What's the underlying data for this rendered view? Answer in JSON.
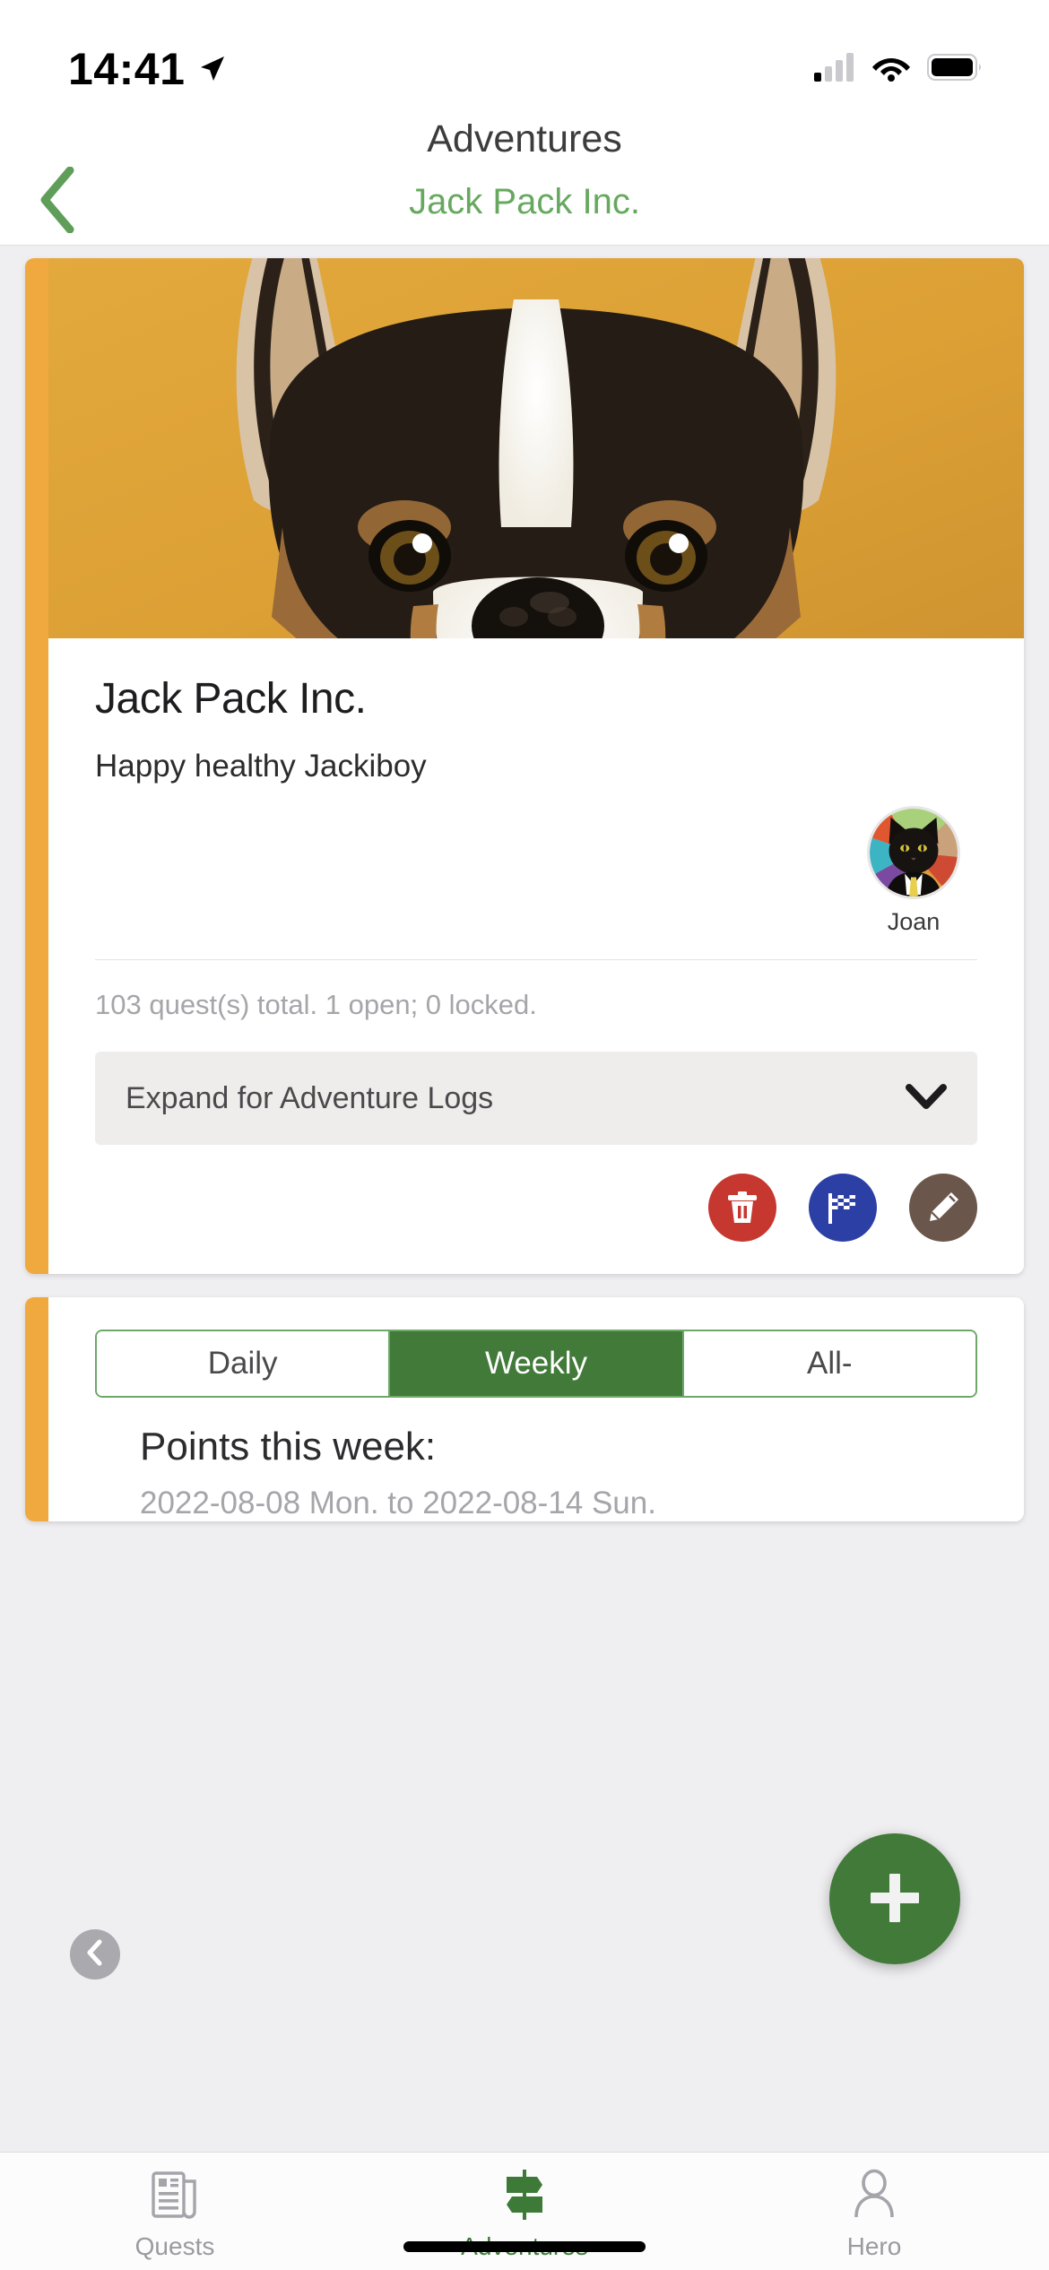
{
  "status_bar": {
    "time": "14:41",
    "location_icon": "location-arrow-icon",
    "cellular_icon": "cellular-signal-icon",
    "wifi_icon": "wifi-icon",
    "battery_icon": "battery-icon"
  },
  "header": {
    "title": "Adventures"
  },
  "subnav": {
    "back_icon": "chevron-left-icon",
    "title": "Jack Pack Inc.",
    "title_color": "#67a85f"
  },
  "adventure_card": {
    "accent_color": "#f0a93f",
    "photo_alt": "corgi-dog-photo",
    "photo_bg": "#dfa437",
    "title": "Jack Pack Inc.",
    "subtitle": "Happy healthy Jackiboy",
    "members": [
      {
        "name": "Joan",
        "avatar": "cat-in-suit-avatar"
      }
    ],
    "quest_summary": "103 quest(s) total. 1 open; 0 locked.",
    "expand_label": "Expand for Adventure Logs",
    "expand_icon": "chevron-down-icon",
    "actions": [
      {
        "name": "delete-button",
        "icon": "trash-icon",
        "color": "#c6372f"
      },
      {
        "name": "finish-button",
        "icon": "checkered-flag-icon",
        "color": "#2c3fa5"
      },
      {
        "name": "edit-button",
        "icon": "pencil-icon",
        "color": "#6b564b"
      }
    ]
  },
  "points_card": {
    "accent_color": "#f0a93f",
    "segments": [
      {
        "label": "Daily",
        "active": false
      },
      {
        "label": "Weekly",
        "active": true
      },
      {
        "label": "All-",
        "active": false
      }
    ],
    "active_color": "#417a39",
    "border_color": "#6fa769",
    "points_title": "Points this week:",
    "date_range": "2022-08-08 Mon. to 2022-08-14 Sun.",
    "prev_week_icon": "chevron-left-circle-icon"
  },
  "fab": {
    "icon": "plus-icon",
    "color": "#417a39",
    "label": "add"
  },
  "tabbar": {
    "items": [
      {
        "label": "Quests",
        "icon": "newspaper-icon",
        "active": false
      },
      {
        "label": "Adventures",
        "icon": "signpost-icon",
        "active": true
      },
      {
        "label": "Hero",
        "icon": "person-icon",
        "active": false
      }
    ],
    "active_color": "#3d7a37",
    "inactive_color": "#9a9aa0"
  }
}
